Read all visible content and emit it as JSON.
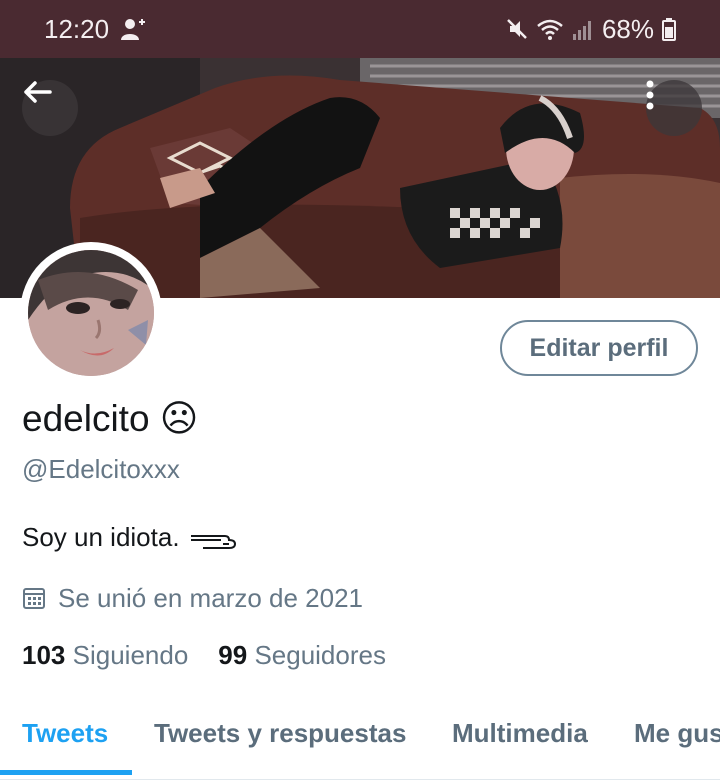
{
  "status_bar": {
    "time": "12:20",
    "battery": "68%",
    "icons": [
      "person-add-icon",
      "mute-icon",
      "wifi-icon",
      "signal-icon",
      "battery-icon"
    ]
  },
  "header": {
    "back_icon": "arrow-left-icon",
    "more_icon": "more-vertical-icon"
  },
  "profile": {
    "edit_button": "Editar perfil",
    "display_name": "edelcito ☹",
    "handle": "@Edelcitoxxx",
    "bio": "Soy un idiota.",
    "joined_icon": "calendar-icon",
    "joined": "Se unió en marzo de 2021",
    "following_count": "103",
    "following_label": "Siguiendo",
    "followers_count": "99",
    "followers_label": "Seguidores"
  },
  "tabs": [
    {
      "label": "Tweets",
      "active": true
    },
    {
      "label": "Tweets y respuestas",
      "active": false
    },
    {
      "label": "Multimedia",
      "active": false
    },
    {
      "label": "Me gusta",
      "active": false
    }
  ],
  "colors": {
    "accent": "#1da1f2",
    "status_bar": "#4a2a31",
    "secondary_text": "#657786"
  }
}
